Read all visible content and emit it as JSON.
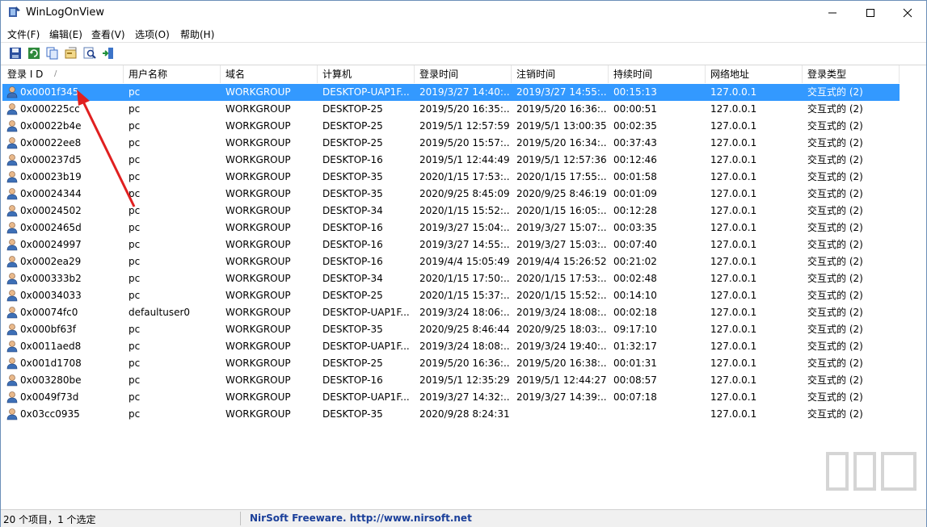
{
  "window": {
    "title": "WinLogOnView",
    "icon": "winlogonview-app-icon"
  },
  "controls": {
    "minimize": "minimize-icon",
    "maximize": "maximize-icon",
    "close": "close-icon"
  },
  "menu": [
    "文件(F)",
    "编辑(E)",
    "查看(V)",
    "选项(O)",
    "帮助(H)"
  ],
  "toolbar": [
    "save-icon",
    "refresh-icon",
    "copy-icon",
    "properties-icon",
    "find-icon",
    "exit-icon"
  ],
  "columns": [
    "登录 I D",
    "用户名称",
    "域名",
    "计算机",
    "登录时间",
    "注销时间",
    "持续时间",
    "网络地址",
    "登录类型"
  ],
  "sort_indicator": "/",
  "rows": [
    [
      "0x0001f345",
      "pc",
      "WORKGROUP",
      "DESKTOP-UAP1F...",
      "2019/3/27 14:40:...",
      "2019/3/27 14:55:...",
      "00:15:13",
      "127.0.0.1",
      "交互式的 (2)"
    ],
    [
      "0x000225cc",
      "pc",
      "WORKGROUP",
      "DESKTOP-25",
      "2019/5/20 16:35:...",
      "2019/5/20 16:36:...",
      "00:00:51",
      "127.0.0.1",
      "交互式的 (2)"
    ],
    [
      "0x00022b4e",
      "pc",
      "WORKGROUP",
      "DESKTOP-25",
      "2019/5/1 12:57:59",
      "2019/5/1 13:00:35",
      "00:02:35",
      "127.0.0.1",
      "交互式的 (2)"
    ],
    [
      "0x00022ee8",
      "pc",
      "WORKGROUP",
      "DESKTOP-25",
      "2019/5/20 15:57:...",
      "2019/5/20 16:34:...",
      "00:37:43",
      "127.0.0.1",
      "交互式的 (2)"
    ],
    [
      "0x000237d5",
      "pc",
      "WORKGROUP",
      "DESKTOP-16",
      "2019/5/1 12:44:49",
      "2019/5/1 12:57:36",
      "00:12:46",
      "127.0.0.1",
      "交互式的 (2)"
    ],
    [
      "0x00023b19",
      "pc",
      "WORKGROUP",
      "DESKTOP-35",
      "2020/1/15 17:53:...",
      "2020/1/15 17:55:...",
      "00:01:58",
      "127.0.0.1",
      "交互式的 (2)"
    ],
    [
      "0x00024344",
      "pc",
      "WORKGROUP",
      "DESKTOP-35",
      "2020/9/25 8:45:09",
      "2020/9/25 8:46:19",
      "00:01:09",
      "127.0.0.1",
      "交互式的 (2)"
    ],
    [
      "0x00024502",
      "pc",
      "WORKGROUP",
      "DESKTOP-34",
      "2020/1/15 15:52:...",
      "2020/1/15 16:05:...",
      "00:12:28",
      "127.0.0.1",
      "交互式的 (2)"
    ],
    [
      "0x0002465d",
      "pc",
      "WORKGROUP",
      "DESKTOP-16",
      "2019/3/27 15:04:...",
      "2019/3/27 15:07:...",
      "00:03:35",
      "127.0.0.1",
      "交互式的 (2)"
    ],
    [
      "0x00024997",
      "pc",
      "WORKGROUP",
      "DESKTOP-16",
      "2019/3/27 14:55:...",
      "2019/3/27 15:03:...",
      "00:07:40",
      "127.0.0.1",
      "交互式的 (2)"
    ],
    [
      "0x0002ea29",
      "pc",
      "WORKGROUP",
      "DESKTOP-16",
      "2019/4/4 15:05:49",
      "2019/4/4 15:26:52",
      "00:21:02",
      "127.0.0.1",
      "交互式的 (2)"
    ],
    [
      "0x000333b2",
      "pc",
      "WORKGROUP",
      "DESKTOP-34",
      "2020/1/15 17:50:...",
      "2020/1/15 17:53:...",
      "00:02:48",
      "127.0.0.1",
      "交互式的 (2)"
    ],
    [
      "0x00034033",
      "pc",
      "WORKGROUP",
      "DESKTOP-25",
      "2020/1/15 15:37:...",
      "2020/1/15 15:52:...",
      "00:14:10",
      "127.0.0.1",
      "交互式的 (2)"
    ],
    [
      "0x00074fc0",
      "defaultuser0",
      "WORKGROUP",
      "DESKTOP-UAP1F...",
      "2019/3/24 18:06:...",
      "2019/3/24 18:08:...",
      "00:02:18",
      "127.0.0.1",
      "交互式的 (2)"
    ],
    [
      "0x000bf63f",
      "pc",
      "WORKGROUP",
      "DESKTOP-35",
      "2020/9/25 8:46:44",
      "2020/9/25 18:03:...",
      "09:17:10",
      "127.0.0.1",
      "交互式的 (2)"
    ],
    [
      "0x0011aed8",
      "pc",
      "WORKGROUP",
      "DESKTOP-UAP1F...",
      "2019/3/24 18:08:...",
      "2019/3/24 19:40:...",
      "01:32:17",
      "127.0.0.1",
      "交互式的 (2)"
    ],
    [
      "0x001d1708",
      "pc",
      "WORKGROUP",
      "DESKTOP-25",
      "2019/5/20 16:36:...",
      "2019/5/20 16:38:...",
      "00:01:31",
      "127.0.0.1",
      "交互式的 (2)"
    ],
    [
      "0x003280be",
      "pc",
      "WORKGROUP",
      "DESKTOP-16",
      "2019/5/1 12:35:29",
      "2019/5/1 12:44:27",
      "00:08:57",
      "127.0.0.1",
      "交互式的 (2)"
    ],
    [
      "0x0049f73d",
      "pc",
      "WORKGROUP",
      "DESKTOP-UAP1F...",
      "2019/3/27 14:32:...",
      "2019/3/27 14:39:...",
      "00:07:18",
      "127.0.0.1",
      "交互式的 (2)"
    ],
    [
      "0x03cc0935",
      "pc",
      "WORKGROUP",
      "DESKTOP-35",
      "2020/9/28 8:24:31",
      "",
      "",
      "127.0.0.1",
      "交互式的 (2)"
    ]
  ],
  "selected_index": 0,
  "row_icon": "user-icon",
  "status": {
    "left": "20 个项目，1 个选定",
    "link": "NirSoft Freeware.  http://www.nirsoft.net"
  },
  "colors": {
    "selection": "#3399ff",
    "link": "#1a3f9a",
    "annotation_arrow": "#e02020"
  }
}
